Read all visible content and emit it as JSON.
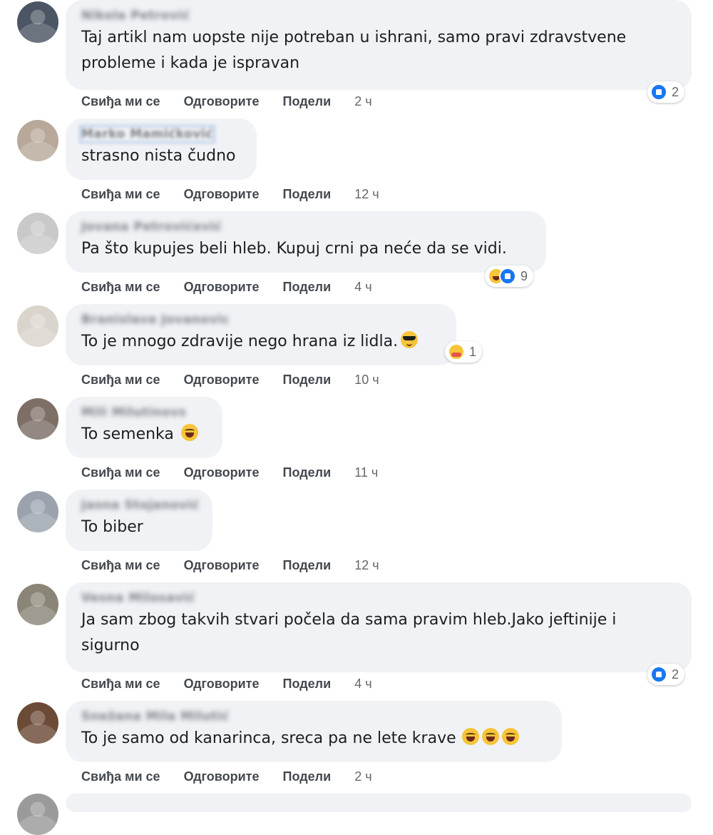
{
  "actions": {
    "like": "Свиђа ми се",
    "reply": "Одговорите",
    "share": "Подели"
  },
  "colors": {
    "bubble": "#f0f2f5",
    "like_blue": "#1877f2",
    "action_text": "#444950"
  },
  "comments": [
    {
      "author": "Nikola Petrović",
      "text_lines": [
        "Taj artikl nam uopste nije potreban u ishrani, samo pravi zdravstvene",
        "probleme i kada je ispravan"
      ],
      "time": "2 ч",
      "reactions": {
        "icons": [
          "like"
        ],
        "count": "2"
      },
      "avatar_color": "#4b5563"
    },
    {
      "author": "Marko Mamićković",
      "text_lines": [
        "strasno nista čudno"
      ],
      "time": "12 ч",
      "avatar_color": "#b8a89a"
    },
    {
      "author": "Jovana Petrovićević",
      "text_lines": [
        "Pa što kupujes beli hleb. Kupuj crni pa neće da se vidi."
      ],
      "time": "4 ч",
      "reactions": {
        "icons": [
          "haha",
          "like"
        ],
        "count": "9"
      },
      "avatar_color": "#c9c9c9"
    },
    {
      "author": "Branislava Jovanovic",
      "text_lines": [
        "To je mnogo zdravije nego hrana iz lidla."
      ],
      "text_emoji": [
        "cool"
      ],
      "time": "10 ч",
      "reactions": {
        "icons": [
          "care"
        ],
        "count": "1"
      },
      "avatar_color": "#d9d4cc"
    },
    {
      "author": "Mili Milutinovs",
      "text_lines": [
        "To semenka"
      ],
      "text_emoji": [
        "laugh"
      ],
      "time": "11 ч",
      "avatar_color": "#7d6f66"
    },
    {
      "author": "Jasna Stojanović",
      "text_lines": [
        "To biber"
      ],
      "time": "12 ч",
      "avatar_color": "#9aa3ad"
    },
    {
      "author": "Vesna Milosavić",
      "text_lines": [
        "Ja sam zbog takvih stvari počela da sama pravim hleb.Jako jeftinije i",
        "sigurno"
      ],
      "time": "4 ч",
      "reactions": {
        "icons": [
          "like"
        ],
        "count": "2"
      },
      "avatar_color": "#8a8577"
    },
    {
      "author": "Snežana Mila Milutić",
      "text_lines": [
        "To je samo od kanarinca, sreca pa ne lete krave"
      ],
      "text_emoji": [
        "laugh",
        "laugh",
        "laugh"
      ],
      "time": "2 ч",
      "avatar_color": "#6b4a36"
    }
  ]
}
